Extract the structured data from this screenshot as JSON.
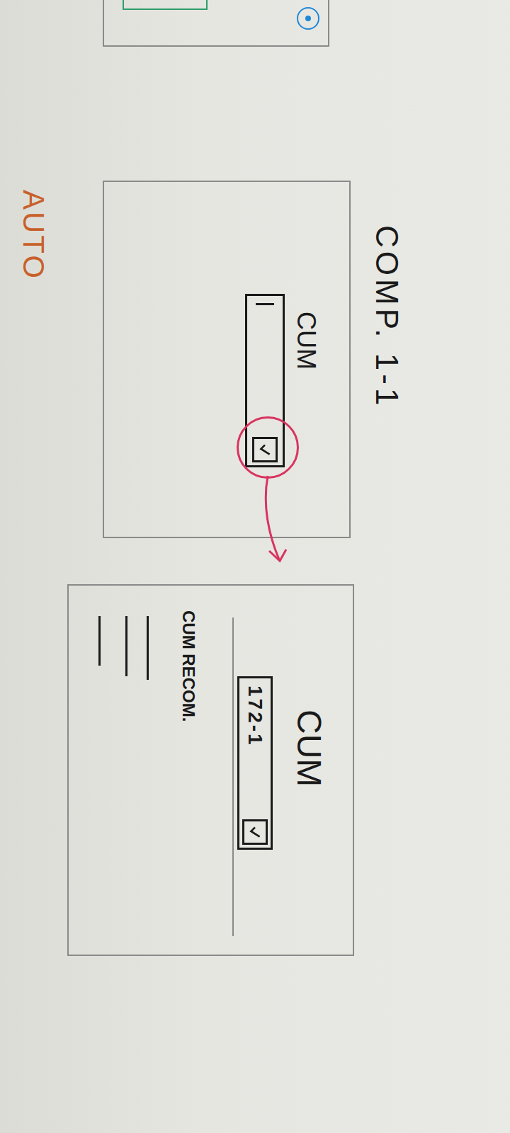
{
  "sheet": {
    "title": "COMP. 1-1",
    "note": "AUTO"
  },
  "screens": [
    {
      "label": "CUM",
      "field": {
        "value": "",
        "caret": true,
        "checked": true
      },
      "highlighted": true
    },
    {
      "label": "CUM",
      "field": {
        "value": "172-1",
        "caret": false,
        "checked": true
      },
      "highlighted": false,
      "caption": "CUM RECOM.",
      "lines": 3
    }
  ]
}
